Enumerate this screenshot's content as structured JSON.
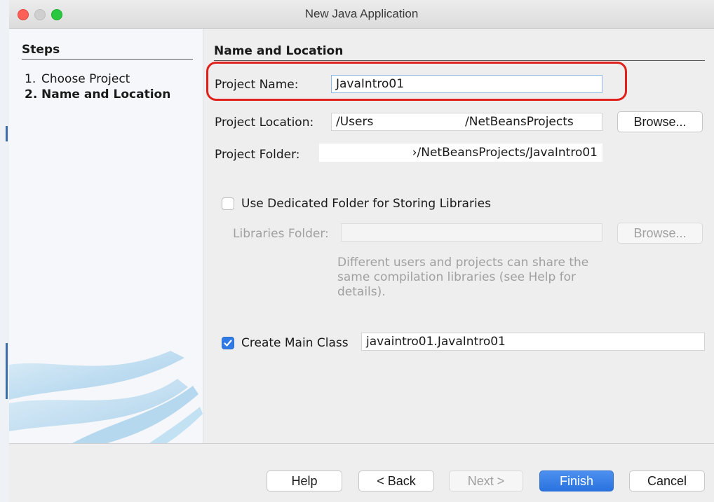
{
  "window": {
    "title": "New Java Application"
  },
  "steps": {
    "heading": "Steps",
    "items": [
      {
        "number": "1.",
        "label": "Choose Project",
        "current": false
      },
      {
        "number": "2.",
        "label": "Name and Location",
        "current": true
      }
    ]
  },
  "form": {
    "section_heading": "Name and Location",
    "project_name": {
      "label": "Project Name:",
      "value": "JavaIntro01"
    },
    "project_location": {
      "label": "Project Location:",
      "value_start": "/Users",
      "value_end": "/NetBeansProjects",
      "browse_label": "Browse..."
    },
    "project_folder": {
      "label": "Project Folder:",
      "value_visible": "›/NetBeansProjects/JavaIntro01"
    },
    "dedicated_folder": {
      "label": "Use Dedicated Folder for Storing Libraries",
      "checked": false
    },
    "libraries_folder": {
      "label": "Libraries Folder:",
      "value": "",
      "browse_label": "Browse...",
      "enabled": false
    },
    "hint": "Different users and projects can share the same compilation libraries (see Help for details).",
    "main_class": {
      "label": "Create Main Class",
      "checked": true,
      "value": "javaintro01.JavaIntro01"
    }
  },
  "buttons": {
    "help": "Help",
    "back": "< Back",
    "next": "Next >",
    "finish": "Finish",
    "cancel": "Cancel"
  },
  "colors": {
    "highlight": "#e0201a",
    "accent": "#2f7ae5",
    "disabled_text": "#a0a0a0"
  }
}
